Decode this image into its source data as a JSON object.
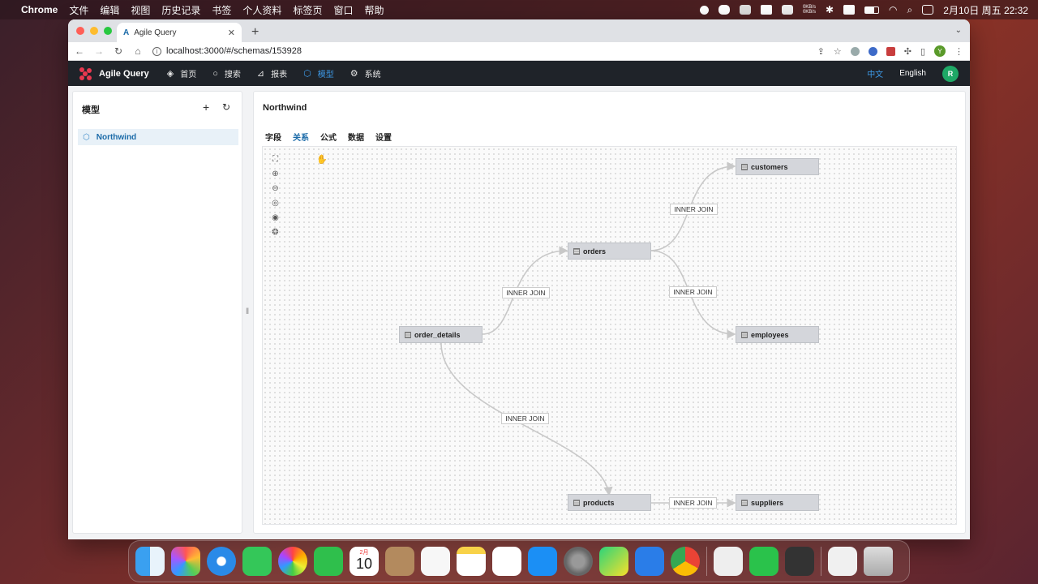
{
  "menubar": {
    "app_name": "Chrome",
    "items": [
      "文件",
      "编辑",
      "视图",
      "历史记录",
      "书签",
      "个人资料",
      "标签页",
      "窗口",
      "帮助"
    ],
    "net_up": "0KB/s",
    "net_down": "0KB/s",
    "datetime": "2月10日 周五  22:32"
  },
  "browser": {
    "tab_title": "Agile Query",
    "url": "localhost:3000/#/schemas/153928",
    "profile_initial": "Y"
  },
  "app": {
    "brand": "Agile Query",
    "nav": [
      {
        "label": "首页",
        "icon": "layers-icon"
      },
      {
        "label": "搜索",
        "icon": "search-icon"
      },
      {
        "label": "报表",
        "icon": "chart-icon"
      },
      {
        "label": "模型",
        "icon": "cube-icon"
      },
      {
        "label": "系统",
        "icon": "gear-icon"
      }
    ],
    "lang_zh": "中文",
    "lang_en": "English",
    "user_initial": "R"
  },
  "sidebar": {
    "title": "模型",
    "items": [
      {
        "label": "Northwind"
      }
    ]
  },
  "main": {
    "title": "Northwind",
    "tabs": [
      "字段",
      "关系",
      "公式",
      "数据",
      "设置"
    ],
    "active_tab": "关系"
  },
  "diagram": {
    "nodes": {
      "customers": "customers",
      "orders": "orders",
      "employees": "employees",
      "order_details": "order_details",
      "products": "products",
      "suppliers": "suppliers"
    },
    "join_label": "INNER JOIN",
    "colors": {
      "node_fill": "#d4d6db",
      "edge": "#c8c8c8",
      "accent": "#1a6aa8"
    }
  },
  "dock": {
    "calendar_month": "2月",
    "calendar_day": "10"
  }
}
